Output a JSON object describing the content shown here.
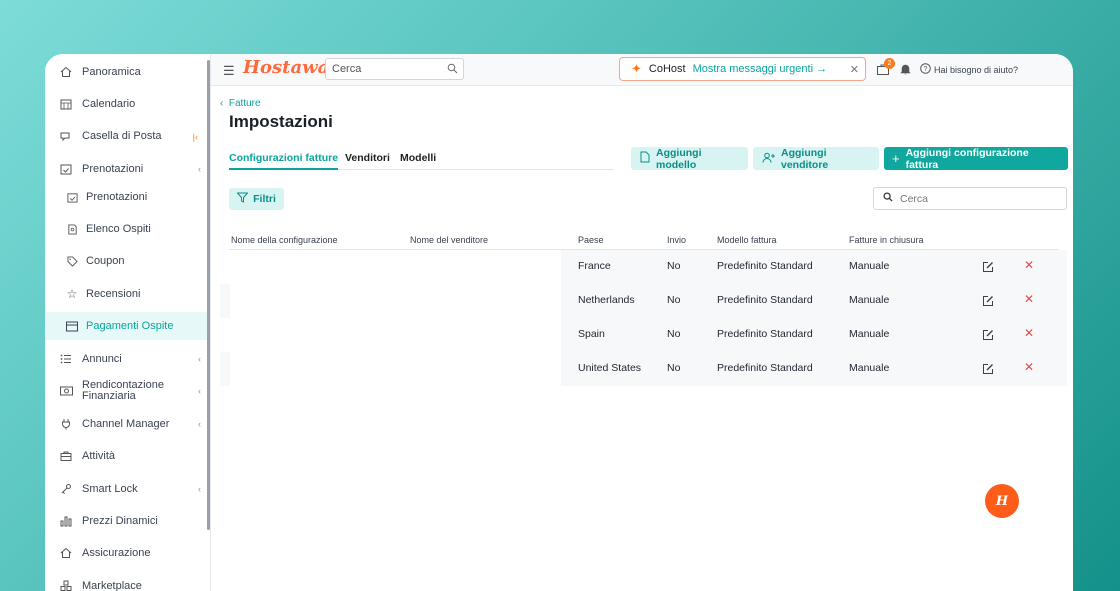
{
  "app": {
    "logo": "Hostaway"
  },
  "topbar": {
    "search_placeholder": "Cerca",
    "cohost_name": "CoHost",
    "cohost_link": "Mostra messaggi urgenti →",
    "notification_count": "2",
    "help_label": "Hai bisogno di aiuto?"
  },
  "sidebar": {
    "items": [
      {
        "label": "Panoramica",
        "icon": "home-icon"
      },
      {
        "label": "Calendario",
        "icon": "calendar-icon"
      },
      {
        "label": "Casella di Posta",
        "icon": "inbox-icon"
      },
      {
        "label": "Prenotazioni",
        "icon": "calendar-check-icon",
        "expandable": true
      },
      {
        "label": "Prenotazioni",
        "icon": "calendar-check-icon",
        "sub": true
      },
      {
        "label": "Elenco Ospiti",
        "icon": "document-icon",
        "sub": true
      },
      {
        "label": "Coupon",
        "icon": "tag-icon",
        "sub": true
      },
      {
        "label": "Recensioni",
        "icon": "star-icon",
        "sub": true
      },
      {
        "label": "Pagamenti Ospite",
        "icon": "credit-card-icon",
        "sub": true,
        "active": true
      },
      {
        "label": "Annunci",
        "icon": "list-icon",
        "expandable": true
      },
      {
        "label": "Rendicontazione Finanziaria",
        "icon": "money-icon",
        "expandable": true
      },
      {
        "label": "Channel Manager",
        "icon": "plug-icon",
        "expandable": true
      },
      {
        "label": "Attività",
        "icon": "briefcase-icon"
      },
      {
        "label": "Smart Lock",
        "icon": "key-icon",
        "expandable": true
      },
      {
        "label": "Prezzi Dinamici",
        "icon": "bar-chart-icon"
      },
      {
        "label": "Assicurazione",
        "icon": "home-shield-icon"
      },
      {
        "label": "Marketplace",
        "icon": "grid-icon"
      }
    ]
  },
  "page": {
    "back_label": "Fatture",
    "title": "Impostazioni",
    "tabs": [
      "Configurazioni fatture",
      "Venditori",
      "Modelli"
    ],
    "buttons": {
      "add_template": "Aggiungi modello",
      "add_vendor": "Aggiungi venditore",
      "add_config": "Aggiungi configurazione fattura"
    },
    "filters_label": "Filtri",
    "search_placeholder": "Cerca"
  },
  "table": {
    "headers": [
      "Nome della configurazione",
      "Nome del venditore",
      "Paese",
      "Invio",
      "Modello fattura",
      "Fatture in chiusura"
    ],
    "rows": [
      {
        "config": "",
        "vendor": "",
        "country": "France",
        "send": "No",
        "template": "Predefinito Standard",
        "closing": "Manuale"
      },
      {
        "config": "",
        "vendor": "",
        "country": "Netherlands",
        "send": "No",
        "template": "Predefinito Standard",
        "closing": "Manuale"
      },
      {
        "config": "",
        "vendor": "",
        "country": "Spain",
        "send": "No",
        "template": "Predefinito Standard",
        "closing": "Manuale"
      },
      {
        "config": "",
        "vendor": "",
        "country": "United States",
        "send": "No",
        "template": "Predefinito Standard",
        "closing": "Manuale"
      }
    ]
  },
  "colors": {
    "accent": "#10a89e",
    "brand": "#ff6a3d",
    "danger": "#e5484d"
  }
}
